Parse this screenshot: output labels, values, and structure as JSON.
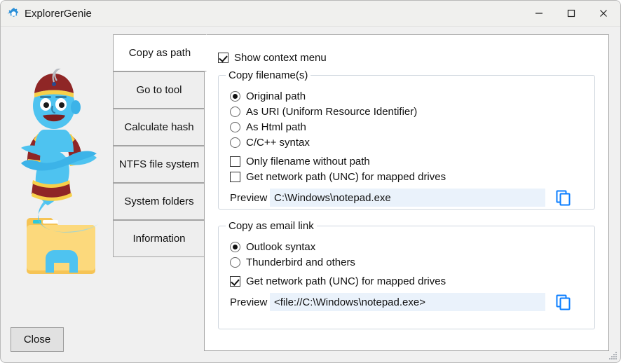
{
  "window": {
    "title": "ExplorerGenie",
    "icon": "gear-icon",
    "controls": {
      "minimize": "–",
      "maximize": "□",
      "close": "✕"
    }
  },
  "accent_color": "#0b7eff",
  "close_button": {
    "label": "Close"
  },
  "tabs": [
    {
      "label": "Copy as path",
      "selected": true
    },
    {
      "label": "Go to tool",
      "selected": false
    },
    {
      "label": "Calculate hash",
      "selected": false
    },
    {
      "label": "NTFS file system",
      "selected": false
    },
    {
      "label": "System folders",
      "selected": false
    },
    {
      "label": "Information",
      "selected": false
    }
  ],
  "panel": {
    "show_context_menu": {
      "label": "Show context menu",
      "checked": true
    },
    "copy_filenames": {
      "title": "Copy filename(s)",
      "radios": [
        {
          "label": "Original path",
          "checked": true
        },
        {
          "label": "As URI (Uniform Resource Identifier)",
          "checked": false
        },
        {
          "label": "As Html path",
          "checked": false
        },
        {
          "label": "C/C++ syntax",
          "checked": false
        }
      ],
      "checkboxes": [
        {
          "label": "Only filename without path",
          "checked": false
        },
        {
          "label": "Get network path (UNC) for mapped drives",
          "checked": false
        }
      ],
      "preview": {
        "label": "Preview",
        "value": "C:\\Windows\\notepad.exe",
        "copy_icon": "copy-icon"
      }
    },
    "copy_email_link": {
      "title": "Copy as email link",
      "radios": [
        {
          "label": "Outlook syntax",
          "checked": true
        },
        {
          "label": "Thunderbird and others",
          "checked": false
        }
      ],
      "checkboxes": [
        {
          "label": "Get network path (UNC) for mapped drives",
          "checked": true
        }
      ],
      "preview": {
        "label": "Preview",
        "value": "<file://C:\\Windows\\notepad.exe>",
        "copy_icon": "copy-icon"
      }
    }
  }
}
